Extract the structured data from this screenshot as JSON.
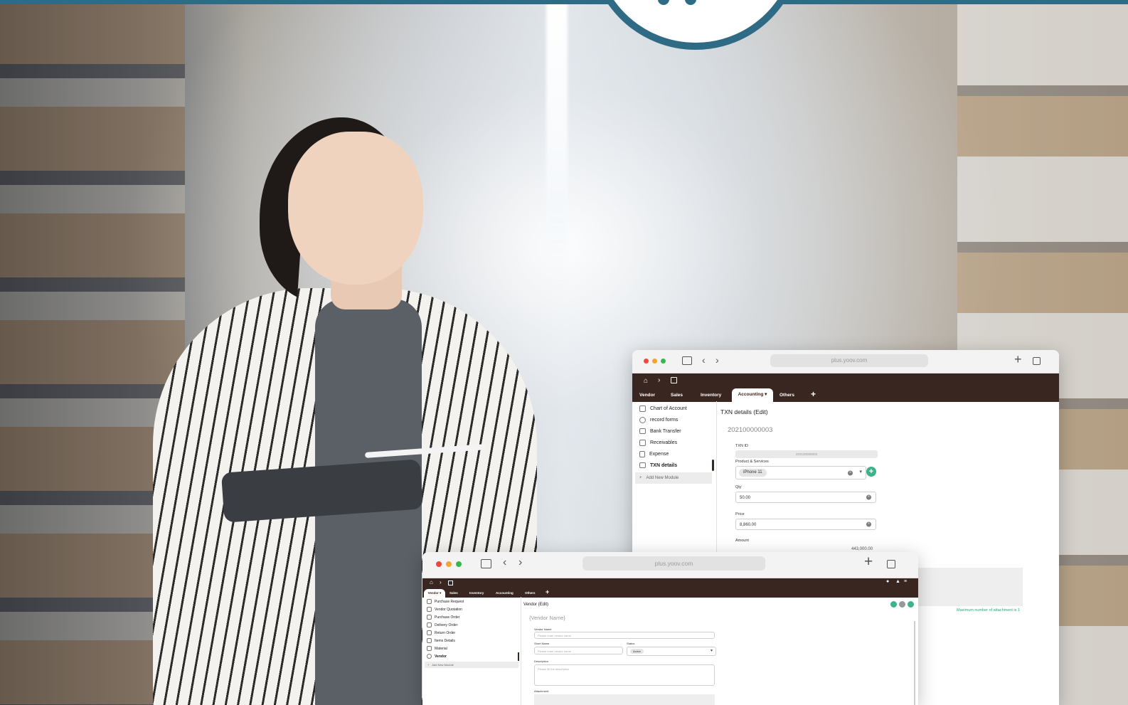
{
  "window_front": {
    "url": "plus.yoov.com",
    "tabs": [
      {
        "label": "Vendor",
        "active": true
      },
      {
        "label": "Sales",
        "active": false
      },
      {
        "label": "Inventory",
        "active": false
      },
      {
        "label": "Accounting",
        "active": false
      },
      {
        "label": "Others",
        "active": false
      }
    ],
    "sidebar": [
      {
        "label": "Purchase Request",
        "icon": "document-icon"
      },
      {
        "label": "Vendor Quotation",
        "icon": "document-icon"
      },
      {
        "label": "Purchase Order",
        "icon": "document-icon"
      },
      {
        "label": "Delivery Order",
        "icon": "truck-icon"
      },
      {
        "label": "Return Order",
        "icon": "return-icon"
      },
      {
        "label": "Items Details",
        "icon": "box-icon"
      },
      {
        "label": "Material",
        "icon": "material-icon"
      },
      {
        "label": "Vendor",
        "icon": "user-icon"
      }
    ],
    "add_module": "Add New Module",
    "page_title": "Vendor (Edit)",
    "record_title": "{Vendor Name}",
    "fields": {
      "vendor_name_label": "Vendor Name",
      "vendor_name_placeholder": "Please enter vendor name",
      "short_name_label": "Short Name",
      "short_name_placeholder": "Please enter vendor name",
      "status_label": "Status",
      "status_value": "Active",
      "description_label": "Description",
      "description_placeholder": "Please fill the description",
      "attachment_label": "Attachment"
    }
  },
  "window_back": {
    "url": "plus.yoov.com",
    "tabs": [
      {
        "label": "Vendor",
        "active": false
      },
      {
        "label": "Sales",
        "active": false
      },
      {
        "label": "Inventory",
        "active": false
      },
      {
        "label": "Accounting",
        "active": true
      },
      {
        "label": "Others",
        "active": false
      }
    ],
    "sidebar": [
      {
        "label": "Chart of Account",
        "icon": "chart-icon"
      },
      {
        "label": "record forms",
        "icon": "form-icon"
      },
      {
        "label": "Bank Transfer",
        "icon": "monitor-icon"
      },
      {
        "label": "Receivables",
        "icon": "hand-icon"
      },
      {
        "label": "Expense",
        "icon": "receipt-icon"
      },
      {
        "label": "TXN details",
        "icon": "monitor-icon"
      }
    ],
    "add_module": "Add New Module",
    "page_title": "TXN details (Edit)",
    "record_id": "202100000003",
    "fields": {
      "txn_id_label": "TXN ID",
      "txn_id_value": "202100000003",
      "product_label": "Product & Services",
      "product_value": "iPhone 11",
      "qty_label": "Qty",
      "qty_value": "50.00",
      "price_label": "Price",
      "price_value": "8,860.00",
      "amount_label": "Amount",
      "amount_value": "443,000.00",
      "attachment_note": "Maximum number of attachment is 1"
    }
  }
}
